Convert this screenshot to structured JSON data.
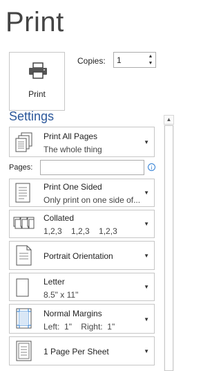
{
  "header": {
    "title": "Print"
  },
  "print_button": {
    "label": "Print",
    "icon": "printer-icon"
  },
  "copies": {
    "label": "Copies:",
    "value": "1"
  },
  "settings": {
    "heading": "Settings"
  },
  "pages": {
    "label": "Pages:",
    "value": "",
    "placeholder": ""
  },
  "options": [
    {
      "title": "Print All Pages",
      "subtitle": "The whole thing",
      "icon": "pages-stack-icon"
    },
    {
      "title": "Print One Sided",
      "subtitle": "Only print on one side of...",
      "icon": "one-sided-icon"
    },
    {
      "title": "Collated",
      "subtitle": "1,2,3    1,2,3    1,2,3",
      "icon": "collated-icon"
    },
    {
      "title": "Portrait Orientation",
      "subtitle": "",
      "icon": "portrait-icon"
    },
    {
      "title": "Letter",
      "subtitle": "8.5\" x 11\"",
      "icon": "paper-size-icon"
    },
    {
      "title": "Normal Margins",
      "subtitle": "Left:  1\"    Right:  1\"",
      "icon": "margins-icon"
    },
    {
      "title": "1 Page Per Sheet",
      "subtitle": "",
      "icon": "page-per-sheet-icon"
    }
  ]
}
